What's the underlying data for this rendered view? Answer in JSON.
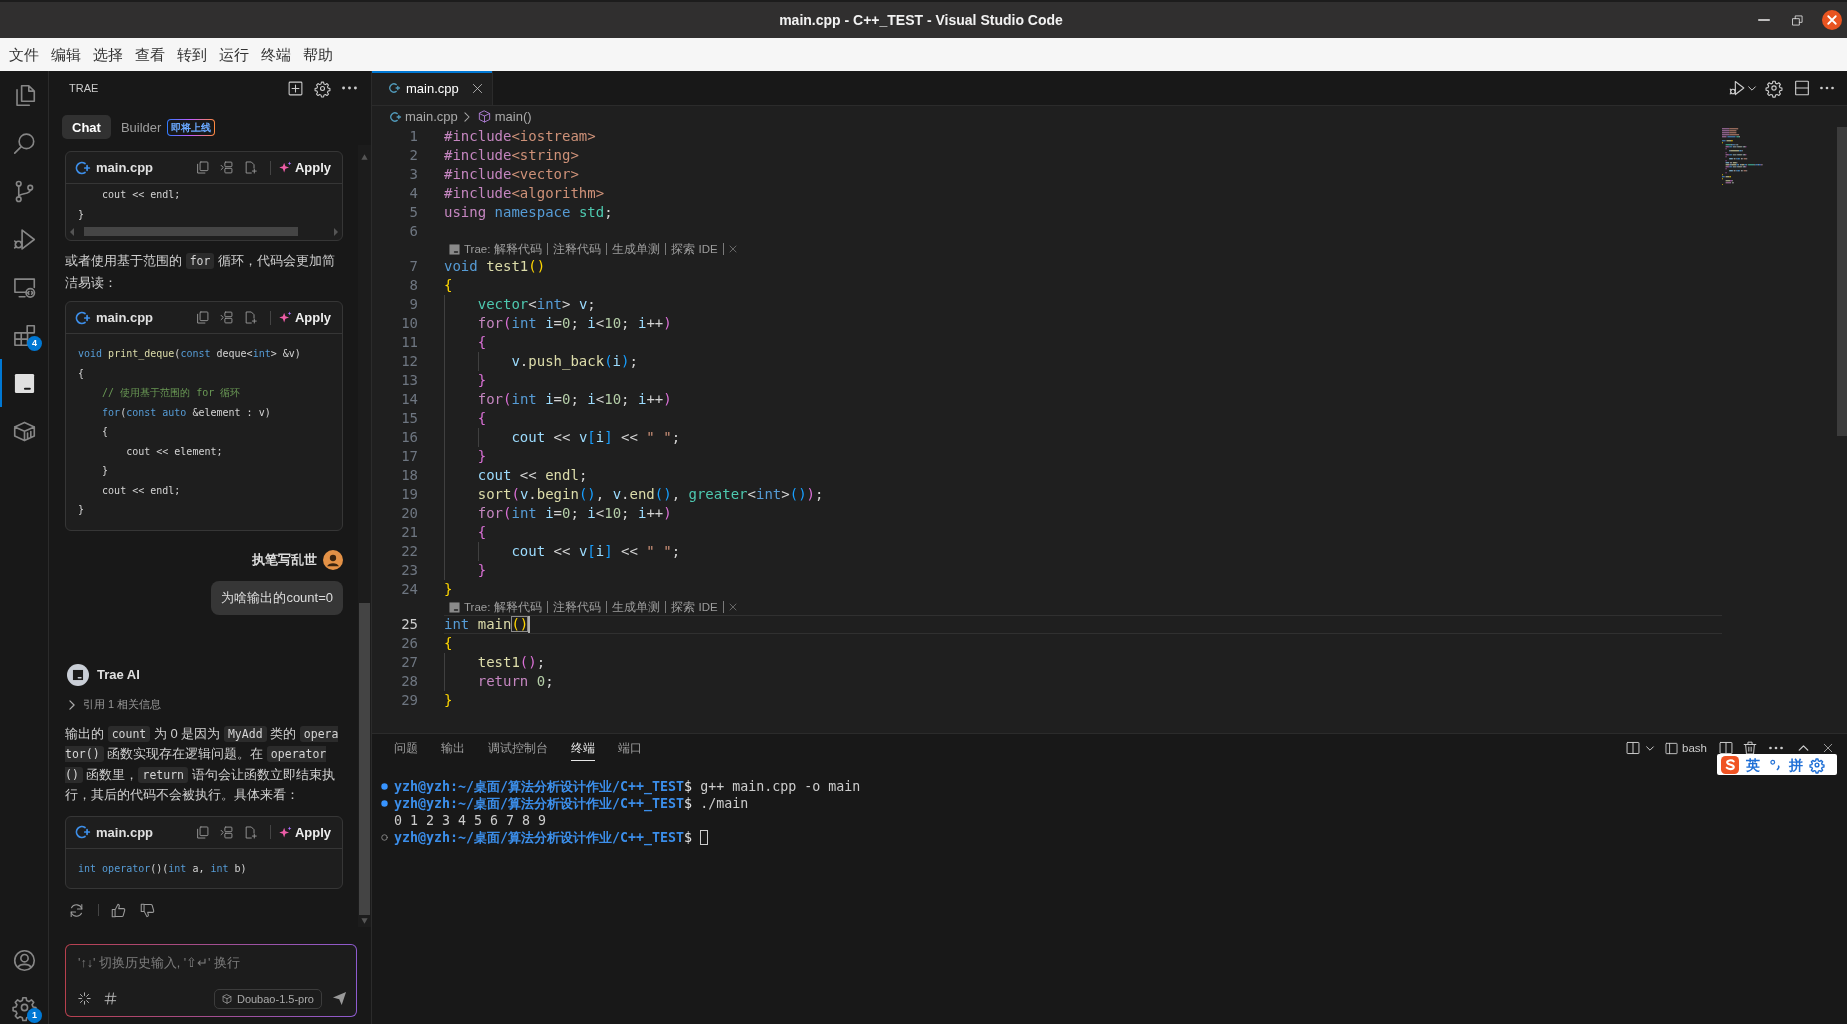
{
  "window": {
    "title": "main.cpp - C++_TEST - Visual Studio Code"
  },
  "menu": [
    "文件",
    "编辑",
    "选择",
    "查看",
    "转到",
    "运行",
    "终端",
    "帮助"
  ],
  "activity_bar": {
    "items": [
      {
        "kind": "explorer",
        "selected": false
      },
      {
        "kind": "search",
        "selected": false
      },
      {
        "kind": "source-control",
        "selected": false
      },
      {
        "kind": "run-debug",
        "selected": false
      },
      {
        "kind": "remote",
        "selected": false
      },
      {
        "kind": "extensions",
        "selected": false,
        "badge": "4"
      },
      {
        "kind": "trae",
        "selected": true
      },
      {
        "kind": "containers",
        "selected": false
      }
    ],
    "bottom_items": [
      {
        "kind": "account"
      },
      {
        "kind": "manage",
        "badge": "1"
      }
    ]
  },
  "side_panel": {
    "title": "TRAE",
    "tabs": [
      {
        "label": "Chat",
        "selected": true
      },
      {
        "label": "Builder",
        "selected": false,
        "tag": "即将上线"
      }
    ],
    "messages": [
      {
        "kind": "code",
        "file": "main.cpp",
        "action": "Apply",
        "horizontal_scrollbar": true,
        "lines": [
          {
            "tokens": [
              {
                "kind": "plain",
                "text": "    cout << endl;"
              }
            ]
          },
          {
            "tokens": [
              {
                "kind": "plain",
                "text": "}"
              }
            ]
          }
        ]
      },
      {
        "kind": "text",
        "parts": [
          {
            "kind": "text",
            "text": "或者使用基于范围的 "
          },
          {
            "kind": "code",
            "text": "for"
          },
          {
            "kind": "text",
            "text": " 循环，代码会更加简洁易读："
          }
        ]
      },
      {
        "kind": "code",
        "file": "main.cpp",
        "action": "Apply",
        "lines": [
          {
            "tokens": [
              {
                "kind": "keyword",
                "text": "void "
              },
              {
                "kind": "function",
                "text": "print_deque"
              },
              {
                "kind": "plain",
                "text": "("
              },
              {
                "kind": "keyword",
                "text": "const"
              },
              {
                "kind": "plain",
                "text": " deque<"
              },
              {
                "kind": "keyword",
                "text": "int"
              },
              {
                "kind": "plain",
                "text": "> &v)"
              }
            ]
          },
          {
            "tokens": [
              {
                "kind": "plain",
                "text": "{"
              }
            ]
          },
          {
            "tokens": [
              {
                "kind": "comment",
                "text": "    // 使用基于范围的 for 循环"
              }
            ]
          },
          {
            "tokens": [
              {
                "kind": "keyword",
                "text": "    for"
              },
              {
                "kind": "plain",
                "text": "("
              },
              {
                "kind": "keyword",
                "text": "const auto"
              },
              {
                "kind": "plain",
                "text": " &element : v)"
              }
            ]
          },
          {
            "tokens": [
              {
                "kind": "plain",
                "text": "    {"
              }
            ]
          },
          {
            "tokens": [
              {
                "kind": "plain",
                "text": "        cout << element;"
              }
            ]
          },
          {
            "tokens": [
              {
                "kind": "plain",
                "text": "    }"
              }
            ]
          },
          {
            "tokens": [
              {
                "kind": "plain",
                "text": "    cout << endl;"
              }
            ]
          },
          {
            "tokens": [
              {
                "kind": "plain",
                "text": "}"
              }
            ]
          }
        ]
      },
      {
        "kind": "user",
        "name": "执笔写乱世",
        "text": "为啥输出的count=0"
      },
      {
        "kind": "assistant",
        "name": "Trae AI"
      },
      {
        "kind": "reference",
        "label": "引用 1 相关信息",
        "expanded": false
      },
      {
        "kind": "text",
        "parts": [
          {
            "kind": "text",
            "text": "输出的 "
          },
          {
            "kind": "code",
            "text": "count"
          },
          {
            "kind": "text",
            "text": " 为 0 是因为 "
          },
          {
            "kind": "code",
            "text": "MyAdd"
          },
          {
            "kind": "text",
            "text": " 类的 "
          },
          {
            "kind": "code",
            "text": "operator()"
          },
          {
            "kind": "text",
            "text": " 函数实现存在逻辑问题。在 "
          },
          {
            "kind": "code",
            "text": "operator()"
          },
          {
            "kind": "text",
            "text": " 函数里，"
          },
          {
            "kind": "code",
            "text": "return"
          },
          {
            "kind": "text",
            "text": " 语句会让函数立即结束执行，其后的代码不会被执行。具体来看："
          }
        ]
      },
      {
        "kind": "code",
        "file": "main.cpp",
        "action": "Apply",
        "lines": [
          {
            "tokens": [
              {
                "kind": "keyword",
                "text": "int "
              },
              {
                "kind": "keyword",
                "text": "operator"
              },
              {
                "kind": "plain",
                "text": "()("
              },
              {
                "kind": "keyword",
                "text": "int"
              },
              {
                "kind": "plain",
                "text": " a, "
              },
              {
                "kind": "keyword",
                "text": "int"
              },
              {
                "kind": "plain",
                "text": " b)"
              }
            ]
          }
        ]
      },
      {
        "kind": "feedback"
      }
    ],
    "input": {
      "placeholder": "'↑↓' 切换历史输入, '⇧↵' 换行",
      "model": "Doubao-1.5-pro"
    }
  },
  "editor": {
    "tabs": [
      {
        "label": "main.cpp",
        "selected": true
      }
    ],
    "breadcrumb": [
      {
        "kind": "file",
        "label": "main.cpp"
      },
      {
        "kind": "symbol",
        "label": "main()"
      }
    ],
    "lines": [
      {
        "kind": "code",
        "number": "1",
        "current": false,
        "tokens": [
          {
            "kind": "control",
            "text": "#include"
          },
          {
            "kind": "string",
            "text": "<iostream>"
          }
        ]
      },
      {
        "kind": "code",
        "number": "2",
        "current": false,
        "tokens": [
          {
            "kind": "control",
            "text": "#include"
          },
          {
            "kind": "string",
            "text": "<string>"
          }
        ]
      },
      {
        "kind": "code",
        "number": "3",
        "current": false,
        "tokens": [
          {
            "kind": "control",
            "text": "#include"
          },
          {
            "kind": "string",
            "text": "<vector>"
          }
        ]
      },
      {
        "kind": "code",
        "number": "4",
        "current": false,
        "tokens": [
          {
            "kind": "control",
            "text": "#include"
          },
          {
            "kind": "string",
            "text": "<algorithm>"
          }
        ]
      },
      {
        "kind": "code",
        "number": "5",
        "current": false,
        "tokens": [
          {
            "kind": "control",
            "text": "using "
          },
          {
            "kind": "keyword",
            "text": "namespace "
          },
          {
            "kind": "type",
            "text": "std"
          },
          {
            "kind": "plain",
            "text": ";"
          }
        ]
      },
      {
        "kind": "code",
        "number": "6",
        "current": false
      },
      {
        "kind": "codelens",
        "label": "Trae:",
        "actions": [
          "解释代码",
          "注释代码",
          "生成单测",
          "探索 IDE"
        ]
      },
      {
        "kind": "code",
        "number": "7",
        "current": false,
        "tokens": [
          {
            "kind": "keyword",
            "text": "void "
          },
          {
            "kind": "function",
            "text": "test1"
          },
          {
            "kind": "bracket1",
            "text": "()"
          }
        ]
      },
      {
        "kind": "code",
        "number": "8",
        "current": false,
        "tokens": [
          {
            "kind": "bracket1",
            "text": "{"
          }
        ]
      },
      {
        "kind": "code",
        "number": "9",
        "current": false,
        "tokens": [
          {
            "kind": "type",
            "text": "    vector"
          },
          {
            "kind": "plain",
            "text": "<"
          },
          {
            "kind": "keyword",
            "text": "int"
          },
          {
            "kind": "plain",
            "text": "> "
          },
          {
            "kind": "variable",
            "text": "v"
          },
          {
            "kind": "plain",
            "text": ";"
          }
        ]
      },
      {
        "kind": "code",
        "number": "10",
        "current": false,
        "tokens": [
          {
            "kind": "control",
            "text": "    for"
          },
          {
            "kind": "bracket2",
            "text": "("
          },
          {
            "kind": "keyword",
            "text": "int "
          },
          {
            "kind": "variable",
            "text": "i"
          },
          {
            "kind": "plain",
            "text": "="
          },
          {
            "kind": "number",
            "text": "0"
          },
          {
            "kind": "plain",
            "text": "; "
          },
          {
            "kind": "variable",
            "text": "i"
          },
          {
            "kind": "plain",
            "text": "<"
          },
          {
            "kind": "number",
            "text": "10"
          },
          {
            "kind": "plain",
            "text": "; "
          },
          {
            "kind": "variable",
            "text": "i"
          },
          {
            "kind": "plain",
            "text": "++"
          },
          {
            "kind": "bracket2",
            "text": ")"
          }
        ]
      },
      {
        "kind": "code",
        "number": "11",
        "current": false,
        "tokens": [
          {
            "kind": "bracket2",
            "text": "    {"
          }
        ]
      },
      {
        "kind": "code",
        "number": "12",
        "current": false,
        "tokens": [
          {
            "kind": "variable",
            "text": "        v"
          },
          {
            "kind": "plain",
            "text": "."
          },
          {
            "kind": "function",
            "text": "push_back"
          },
          {
            "kind": "bracket3",
            "text": "("
          },
          {
            "kind": "variable",
            "text": "i"
          },
          {
            "kind": "bracket3",
            "text": ")"
          },
          {
            "kind": "plain",
            "text": ";"
          }
        ]
      },
      {
        "kind": "code",
        "number": "13",
        "current": false,
        "tokens": [
          {
            "kind": "bracket2",
            "text": "    }"
          }
        ]
      },
      {
        "kind": "code",
        "number": "14",
        "current": false,
        "tokens": [
          {
            "kind": "control",
            "text": "    for"
          },
          {
            "kind": "bracket2",
            "text": "("
          },
          {
            "kind": "keyword",
            "text": "int "
          },
          {
            "kind": "variable",
            "text": "i"
          },
          {
            "kind": "plain",
            "text": "="
          },
          {
            "kind": "number",
            "text": "0"
          },
          {
            "kind": "plain",
            "text": "; "
          },
          {
            "kind": "variable",
            "text": "i"
          },
          {
            "kind": "plain",
            "text": "<"
          },
          {
            "kind": "number",
            "text": "10"
          },
          {
            "kind": "plain",
            "text": "; "
          },
          {
            "kind": "variable",
            "text": "i"
          },
          {
            "kind": "plain",
            "text": "++"
          },
          {
            "kind": "bracket2",
            "text": ")"
          }
        ]
      },
      {
        "kind": "code",
        "number": "15",
        "current": false,
        "tokens": [
          {
            "kind": "bracket2",
            "text": "    {"
          }
        ]
      },
      {
        "kind": "code",
        "number": "16",
        "current": false,
        "tokens": [
          {
            "kind": "variable",
            "text": "        cout"
          },
          {
            "kind": "plain",
            "text": " << "
          },
          {
            "kind": "variable",
            "text": "v"
          },
          {
            "kind": "bracket3",
            "text": "["
          },
          {
            "kind": "variable",
            "text": "i"
          },
          {
            "kind": "bracket3",
            "text": "]"
          },
          {
            "kind": "plain",
            "text": " << "
          },
          {
            "kind": "string",
            "text": "\" \""
          },
          {
            "kind": "plain",
            "text": ";"
          }
        ]
      },
      {
        "kind": "code",
        "number": "17",
        "current": false,
        "tokens": [
          {
            "kind": "bracket2",
            "text": "    }"
          }
        ]
      },
      {
        "kind": "code",
        "number": "18",
        "current": false,
        "tokens": [
          {
            "kind": "variable",
            "text": "    cout"
          },
          {
            "kind": "plain",
            "text": " << "
          },
          {
            "kind": "function",
            "text": "endl"
          },
          {
            "kind": "plain",
            "text": ";"
          }
        ]
      },
      {
        "kind": "code",
        "number": "19",
        "current": false,
        "tokens": [
          {
            "kind": "function",
            "text": "    sort"
          },
          {
            "kind": "bracket2",
            "text": "("
          },
          {
            "kind": "variable",
            "text": "v"
          },
          {
            "kind": "plain",
            "text": "."
          },
          {
            "kind": "function",
            "text": "begin"
          },
          {
            "kind": "bracket3",
            "text": "()"
          },
          {
            "kind": "plain",
            "text": ", "
          },
          {
            "kind": "variable",
            "text": "v"
          },
          {
            "kind": "plain",
            "text": "."
          },
          {
            "kind": "function",
            "text": "end"
          },
          {
            "kind": "bracket3",
            "text": "()"
          },
          {
            "kind": "plain",
            "text": ", "
          },
          {
            "kind": "type",
            "text": "greater"
          },
          {
            "kind": "plain",
            "text": "<"
          },
          {
            "kind": "keyword",
            "text": "int"
          },
          {
            "kind": "plain",
            "text": ">"
          },
          {
            "kind": "bracket3",
            "text": "()"
          },
          {
            "kind": "bracket2",
            "text": ")"
          },
          {
            "kind": "plain",
            "text": ";"
          }
        ]
      },
      {
        "kind": "code",
        "number": "20",
        "current": false,
        "tokens": [
          {
            "kind": "control",
            "text": "    for"
          },
          {
            "kind": "bracket2",
            "text": "("
          },
          {
            "kind": "keyword",
            "text": "int "
          },
          {
            "kind": "variable",
            "text": "i"
          },
          {
            "kind": "plain",
            "text": "="
          },
          {
            "kind": "number",
            "text": "0"
          },
          {
            "kind": "plain",
            "text": "; "
          },
          {
            "kind": "variable",
            "text": "i"
          },
          {
            "kind": "plain",
            "text": "<"
          },
          {
            "kind": "number",
            "text": "10"
          },
          {
            "kind": "plain",
            "text": "; "
          },
          {
            "kind": "variable",
            "text": "i"
          },
          {
            "kind": "plain",
            "text": "++"
          },
          {
            "kind": "bracket2",
            "text": ")"
          }
        ]
      },
      {
        "kind": "code",
        "number": "21",
        "current": false,
        "tokens": [
          {
            "kind": "bracket2",
            "text": "    {"
          }
        ]
      },
      {
        "kind": "code",
        "number": "22",
        "current": false,
        "tokens": [
          {
            "kind": "variable",
            "text": "        cout"
          },
          {
            "kind": "plain",
            "text": " << "
          },
          {
            "kind": "variable",
            "text": "v"
          },
          {
            "kind": "bracket3",
            "text": "["
          },
          {
            "kind": "variable",
            "text": "i"
          },
          {
            "kind": "bracket3",
            "text": "]"
          },
          {
            "kind": "plain",
            "text": " << "
          },
          {
            "kind": "string",
            "text": "\" \""
          },
          {
            "kind": "plain",
            "text": ";"
          }
        ]
      },
      {
        "kind": "code",
        "number": "23",
        "current": false,
        "tokens": [
          {
            "kind": "bracket2",
            "text": "    }"
          }
        ]
      },
      {
        "kind": "code",
        "number": "24",
        "current": false,
        "tokens": [
          {
            "kind": "bracket1",
            "text": "}"
          }
        ]
      },
      {
        "kind": "codelens",
        "label": "Trae:",
        "actions": [
          "解释代码",
          "注释代码",
          "生成单测",
          "探索 IDE"
        ]
      },
      {
        "kind": "code",
        "number": "25",
        "current": true,
        "tokens": [
          {
            "kind": "keyword",
            "text": "int "
          },
          {
            "kind": "function",
            "text": "main"
          },
          {
            "kind": "matched",
            "text": "()"
          }
        ]
      },
      {
        "kind": "code",
        "number": "26",
        "current": false,
        "tokens": [
          {
            "kind": "bracket1",
            "text": "{"
          }
        ]
      },
      {
        "kind": "code",
        "number": "27",
        "current": false,
        "tokens": [
          {
            "kind": "function",
            "text": "    test1"
          },
          {
            "kind": "bracket2",
            "text": "()"
          },
          {
            "kind": "plain",
            "text": ";"
          }
        ]
      },
      {
        "kind": "code",
        "number": "28",
        "current": false,
        "tokens": [
          {
            "kind": "control",
            "text": "    return "
          },
          {
            "kind": "number",
            "text": "0"
          },
          {
            "kind": "plain",
            "text": ";"
          }
        ]
      },
      {
        "kind": "code",
        "number": "29",
        "current": false,
        "tokens": [
          {
            "kind": "bracket1",
            "text": "}"
          }
        ]
      }
    ]
  },
  "panel": {
    "tabs": [
      {
        "label": "问题",
        "selected": false
      },
      {
        "label": "输出",
        "selected": false
      },
      {
        "label": "调试控制台",
        "selected": false
      },
      {
        "label": "终端",
        "selected": true
      },
      {
        "label": "端口",
        "selected": false
      }
    ],
    "terminal_profile": "bash",
    "terminal": [
      {
        "kind": "command",
        "completed": true,
        "prompt": "yzh@yzh:~/桌面/算法分析设计作业/C++_TEST",
        "symbol": "$",
        "command": "g++ main.cpp -o main"
      },
      {
        "kind": "command",
        "completed": true,
        "prompt": "yzh@yzh:~/桌面/算法分析设计作业/C++_TEST",
        "symbol": "$",
        "command": "./main"
      },
      {
        "kind": "output",
        "text": "0 1 2 3 4 5 6 7 8 9"
      },
      {
        "kind": "command",
        "completed": false,
        "prompt": "yzh@yzh:~/桌面/算法分析设计作业/C++_TEST",
        "symbol": "$",
        "cursor": true
      }
    ]
  },
  "ime_bar": {
    "language": "英",
    "scheme": "拼"
  }
}
